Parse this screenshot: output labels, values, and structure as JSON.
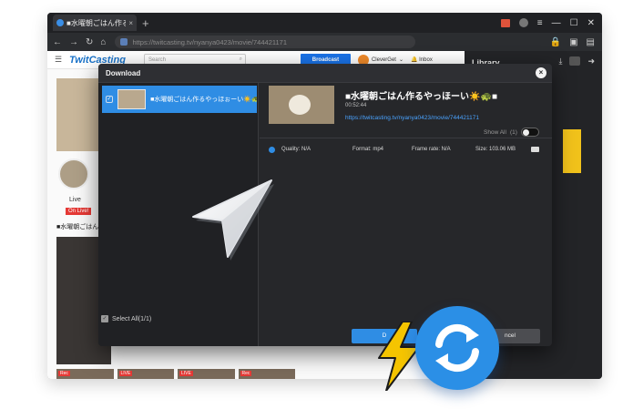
{
  "browser": {
    "tab_title": "■水曜朝ごはん作るやっ",
    "tab_close": "×",
    "new_tab": "+",
    "url": "https://twitcasting.tv/nyanya0423/movie/744421171"
  },
  "site": {
    "logo": "TwitCasting",
    "search_placeholder": "Search",
    "broadcast": "Broadcast",
    "user_name": "CleverGet",
    "inbox": "Inbox",
    "live_label": "Live",
    "on_live": "On Live!",
    "live_title": "■水曜朝ごはん",
    "strip_badges": [
      "Rec",
      "LIVE",
      "LIVE",
      "Rec"
    ]
  },
  "library": {
    "title": "Library"
  },
  "modal": {
    "title": "Download",
    "close_glyph": "×",
    "list_item_title": "■水曜朝ごはん作るやっほぉーい☀️🐢■",
    "select_all": "Select All(1/1)",
    "video_title": "■水曜朝ごはん作るやっほーい☀️🐢■",
    "duration": "00:52:44",
    "video_url": "https://twitcasting.tv/nyanya0423/movie/744421171",
    "show_all": "Show All",
    "show_all_count": "(1)",
    "quality": "Quality: N/A",
    "format": "Format: mp4",
    "frame_rate": "Frame rate: N/A",
    "size": "Size: 103.06 MB",
    "download_btn": "D",
    "cancel_btn": "ncel"
  },
  "colors": {
    "accent": "#2f8de4",
    "bolt": "#f5c400",
    "live_red": "#e53935"
  },
  "icons": [
    "back-icon",
    "forward-icon",
    "reload-icon",
    "home-icon",
    "lock-icon",
    "download-icon",
    "youtube-icon",
    "arrow-icon",
    "cursor-icon",
    "bolt-icon",
    "convert-icon"
  ]
}
